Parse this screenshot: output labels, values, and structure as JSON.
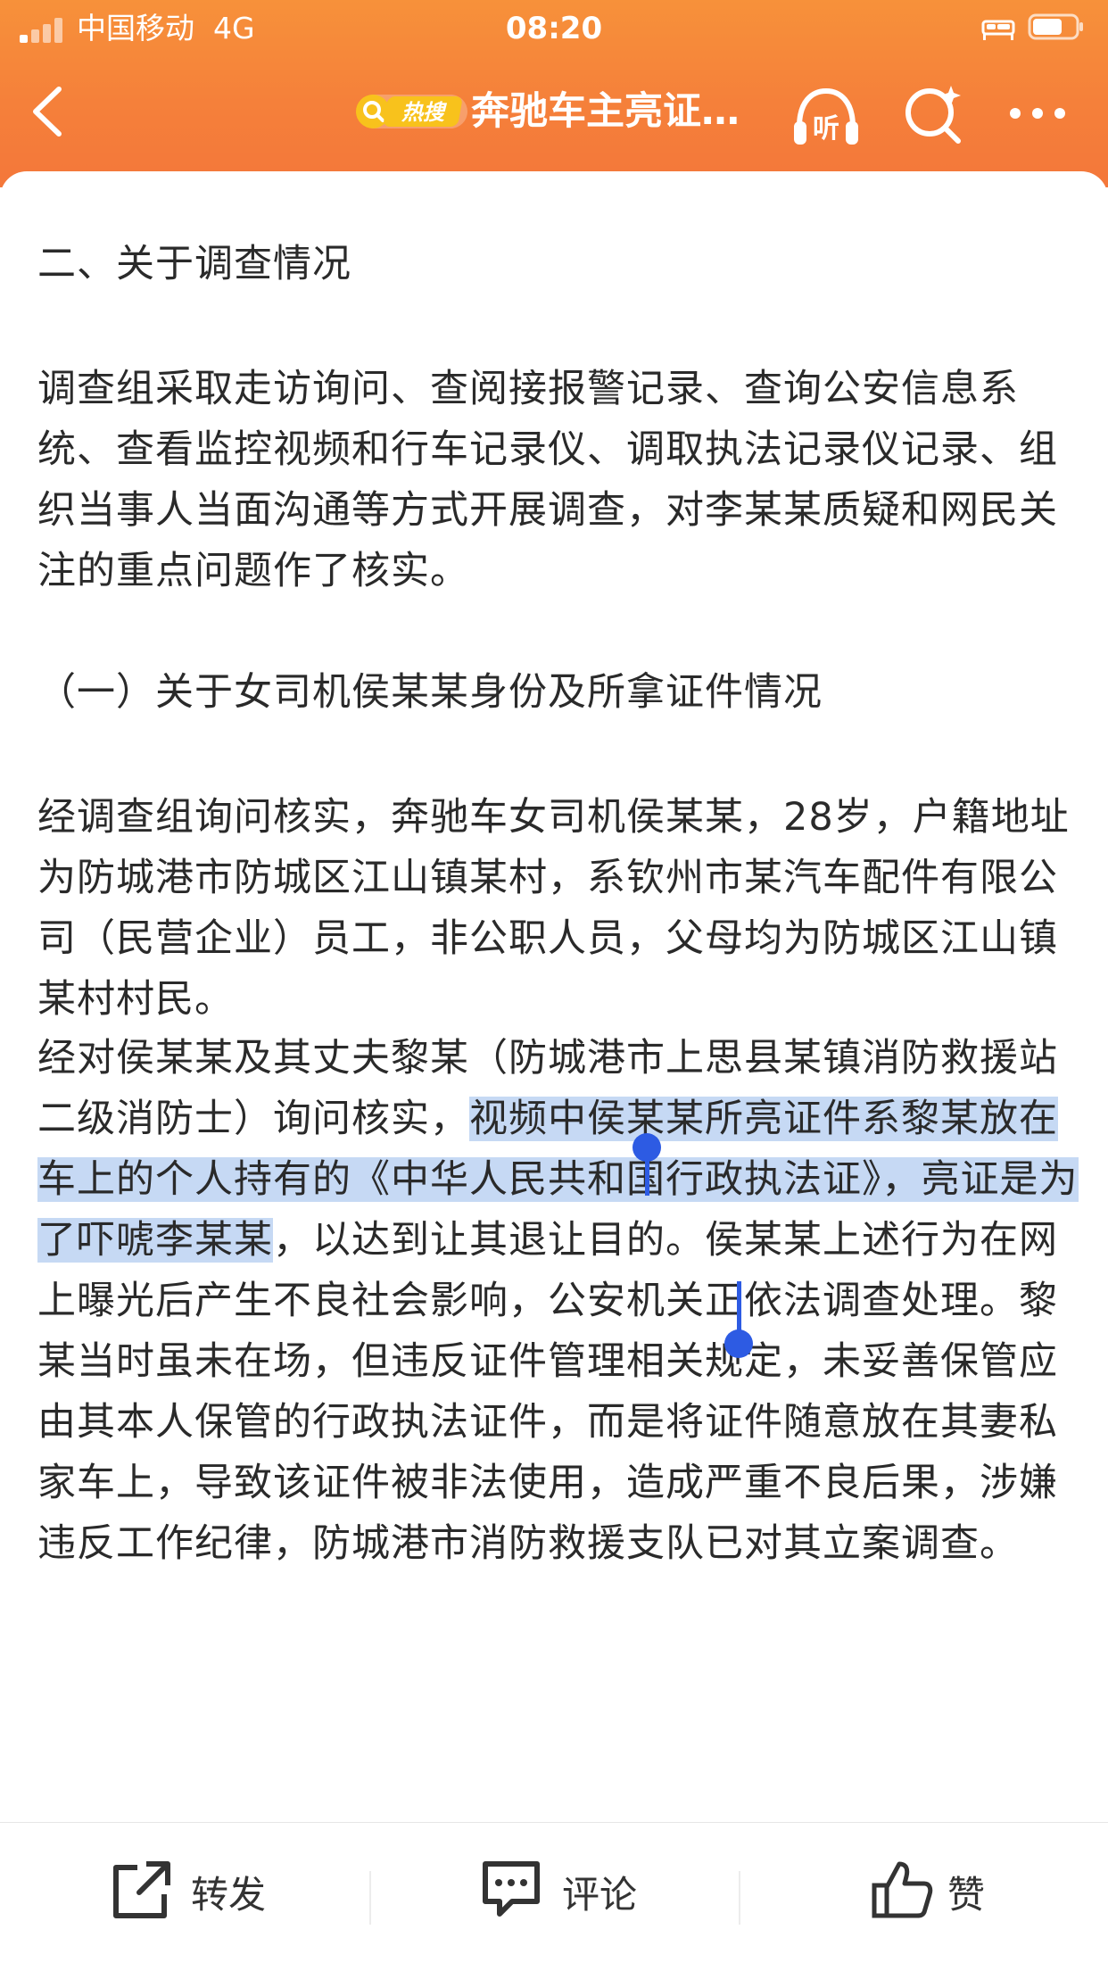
{
  "status_bar": {
    "carrier": "中国移动",
    "network": "4G",
    "time": "08:20"
  },
  "nav": {
    "back_icon": "chevron-left-icon",
    "hot_badge": "热搜",
    "title": "奔驰车主亮证…",
    "listen_label": "听",
    "search_icon": "search-sparkle-icon",
    "more_icon": "more-dots-icon"
  },
  "article": {
    "section_heading": "二、关于调查情况",
    "para1": "调查组采取走访询问、查阅接报警记录、查询公安信息系统、查看监控视频和行车记录仪、调取执法记录仪记录、组织当事人当面沟通等方式开展调查，对李某某质疑和网民关注的重点问题作了核实。",
    "subheading": "（一）关于女司机侯某某身份及所拿证件情况",
    "para2": "经调查组询问核实，奔驰车女司机侯某某，28岁，户籍地址为防城港市防城区江山镇某村，系钦州市某汽车配件有限公司（民营企业）员工，非公职人员，父母均为防城区江山镇某村村民。",
    "para3_before": "经对侯某某及其丈夫黎某（防城港市上思县某镇消防救援站二级消防士）询问核实，",
    "para3_selected": "视频中侯某某所亮证件系黎某放在车上的个人持有的《中华人民共和国行政执法证》，亮证是为了吓唬李某某",
    "para3_after": "，以达到让其退让目的。侯某某上述行为在网上曝光后产生不良社会影响，公安机关正依法调查处理。黎某当时虽未在场，但违反证件管理相关规定，未妥善保管应由其本人保管的行政执法证件，而是将证件随意放在其妻私家车上，导致该证件被非法使用，造成严重不良后果，涉嫌违反工作纪律，防城港市消防救援支队已对其立案调查。"
  },
  "toolbar": {
    "share_label": "转发",
    "comment_label": "评论",
    "like_label": "赞"
  },
  "colors": {
    "header_orange": "#f5803a",
    "selection": "#c6d9f4",
    "selection_handle": "#2d5be3"
  }
}
